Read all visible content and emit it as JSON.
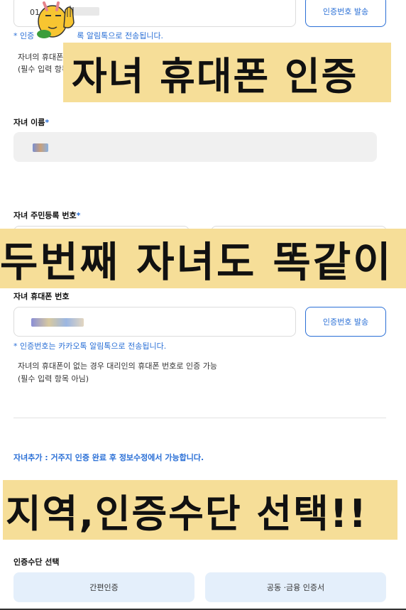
{
  "top_section": {
    "phone_value_masked": "01",
    "verify_button": "인증번호 발송",
    "kakao_note": "* 인증",
    "kakao_note_tail": "록 알림톡으로 전송됩니다.",
    "desc_line1": "자녀의 휴대폰",
    "desc_line2": "(필수 입력 항목"
  },
  "banners": {
    "banner1": "자녀 휴대폰 인증",
    "banner2": "두번째 자녀도 똑같이",
    "banner3": "지역,인증수단 선택!!"
  },
  "child_name": {
    "label": "자녀 이름",
    "required_mark": "*"
  },
  "child_rrn": {
    "label": "자녀 주민등록 번호",
    "required_mark": "*"
  },
  "child_phone": {
    "label": "자녀 휴대폰 번호",
    "verify_button": "인증번호 발송",
    "kakao_note": "* 인증번호는 카카오톡 알림톡으로 전송됩니다.",
    "desc_line1": "자녀의 휴대폰이 없는 경우 대리인의 휴대폰 번호로 인증 가능",
    "desc_line2": "(필수 입력 항목 아님)"
  },
  "add_child_note": "자녀추가 : 거주지 인증 완료 후 정보수정에서 가능합니다.",
  "auth_method": {
    "label": "인증수단 선택",
    "options": [
      "간편인증",
      "공동 ·금융 인증서"
    ]
  },
  "colors": {
    "accent": "#2a6fd6",
    "banner_bg": "#f6de98",
    "option_bg": "#e4effb"
  }
}
